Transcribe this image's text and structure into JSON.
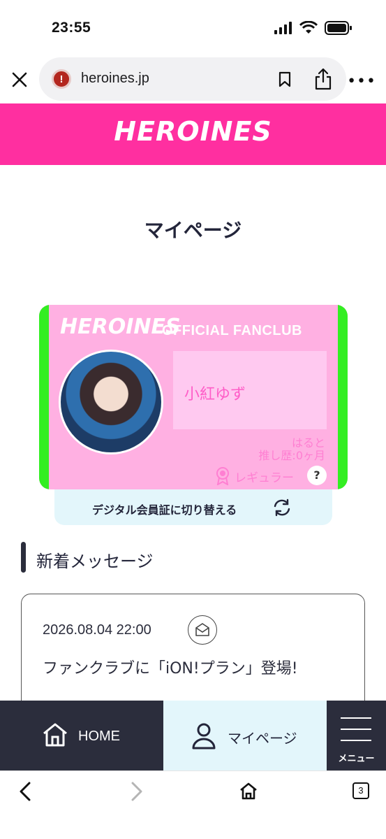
{
  "status_bar": {
    "time": "23:55"
  },
  "browser": {
    "url": "heroines.jp",
    "tab_count": "3"
  },
  "header": {
    "logo": "HEROINES"
  },
  "page": {
    "title": "マイページ"
  },
  "card": {
    "logo": "HEROINES",
    "subtitle": "OFFICIAL FANCLUB",
    "member_name": "小紅ゆず",
    "nickname": "はると",
    "history": "推し歴:0ヶ月",
    "rank": "レギュラー",
    "help": "?",
    "edge_color": "#33ee22",
    "card_color": "#ffb0e2"
  },
  "switch": {
    "label": "デジタル会員証に切り替える"
  },
  "messages": {
    "section_title": "新着メッセージ",
    "items": [
      {
        "date": "2026.08.04 22:00",
        "text": "ファンクラブに「iON!プラン」登場!"
      }
    ]
  },
  "bottom_nav": {
    "home": "HOME",
    "mypage": "マイページ",
    "menu": "メニュー"
  },
  "colors": {
    "brand_pink": "#ff2fa0",
    "nav_dark": "#2b2d3c",
    "nav_active": "#e3f6fb"
  }
}
